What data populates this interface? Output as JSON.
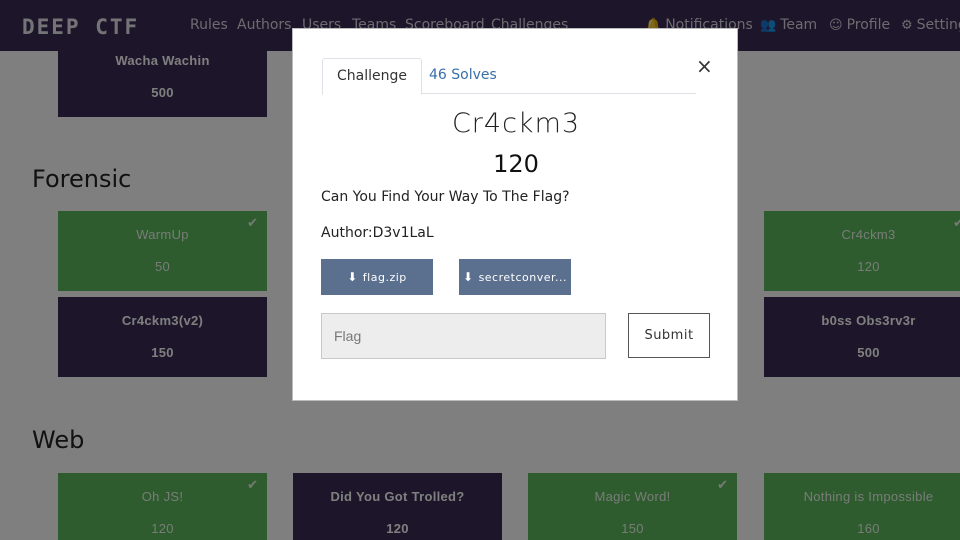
{
  "navbar": {
    "brand": "DEEP CTF",
    "links": [
      "Rules",
      "Authors",
      "Users",
      "Teams",
      "Scoreboard",
      "Challenges"
    ],
    "right_links": [
      {
        "icon": "bell-icon",
        "label": "Notifications"
      },
      {
        "icon": "users-icon",
        "label": "Team"
      },
      {
        "icon": "user-circle-icon",
        "label": "Profile"
      },
      {
        "icon": "gear-icon",
        "label": "Settings"
      }
    ]
  },
  "sections": {
    "top_card": {
      "name": "Wacha Wachin",
      "value": "500"
    },
    "forensic": {
      "title": "Forensic",
      "cards": [
        {
          "name": "WarmUp",
          "value": "50",
          "solved": true
        },
        {
          "name": "Cr4ckm3",
          "value": "120",
          "solved": true
        },
        {
          "name": "Cr4ckm3(v2)",
          "value": "150",
          "solved": false
        },
        {
          "name": "b0ss Obs3rv3r",
          "value": "500",
          "solved": false
        }
      ]
    },
    "web": {
      "title": "Web",
      "cards": [
        {
          "name": "Oh JS!",
          "value": "120",
          "solved": true
        },
        {
          "name": "Did You Got Trolled?",
          "value": "120",
          "solved": false
        },
        {
          "name": "Magic Word!",
          "value": "150",
          "solved": true
        },
        {
          "name": "Nothing is Impossible",
          "value": "160",
          "solved": false
        }
      ]
    }
  },
  "modal": {
    "tabs": [
      "Challenge",
      "46 Solves"
    ],
    "close": "×",
    "title": "Cr4ckm3",
    "value": "120",
    "description": "Can You Find Your Way To The Flag?",
    "author": "Author:D3v1LaL",
    "files": [
      "flag.zip",
      "secretconver..."
    ],
    "flag_placeholder": "Flag",
    "submit": "Submit"
  },
  "colors": {
    "navbar": "#3b2d55",
    "unsolved": "#3b2d55",
    "solved": "#5cb85c",
    "file_button": "#5b6f8f"
  }
}
